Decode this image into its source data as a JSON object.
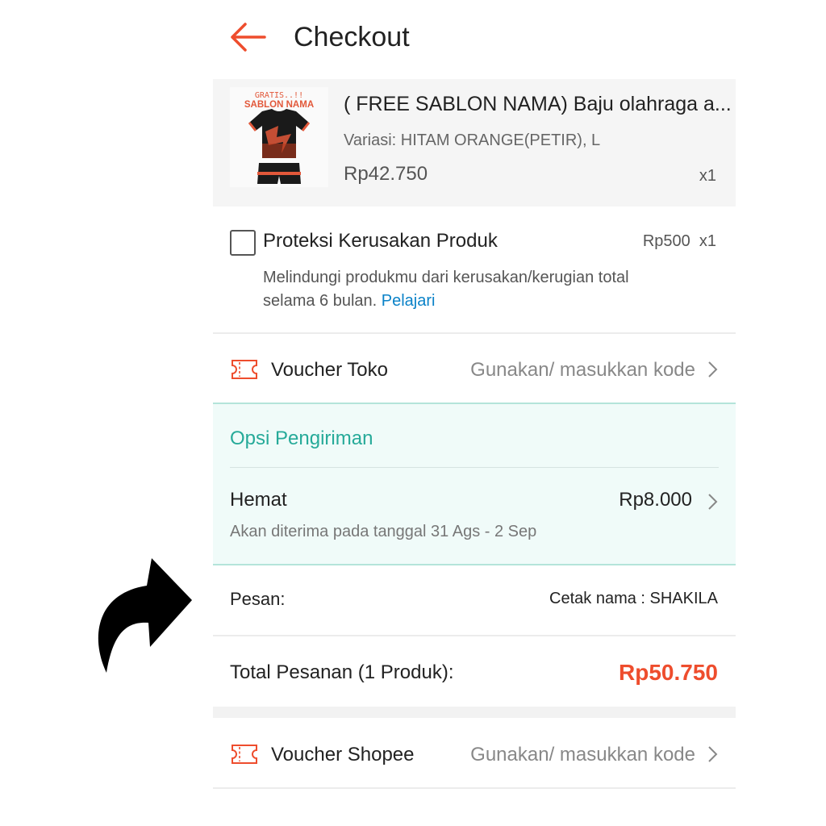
{
  "header": {
    "title": "Checkout"
  },
  "product": {
    "image_caption_top": "GRATIS..!!",
    "image_caption_main": "SABLON NAMA",
    "name": "( FREE SABLON NAMA) Baju olahraga a...",
    "variant": "Variasi: HITAM ORANGE(PETIR), L",
    "price": "Rp42.750",
    "qty": "x1"
  },
  "protection": {
    "title": "Proteksi Kerusakan Produk",
    "price_qty": "Rp500  x1",
    "desc": "Melindungi produkmu dari kerusakan/kerugian total selama 6 bulan.",
    "link": "Pelajari",
    "checked": false
  },
  "voucher_toko": {
    "label": "Voucher Toko",
    "hint": "Gunakan/ masukkan kode"
  },
  "shipping": {
    "section_title": "Opsi Pengiriman",
    "option": "Hemat",
    "price": "Rp8.000",
    "eta": "Akan diterima pada tanggal 31 Ags - 2 Sep"
  },
  "message": {
    "label": "Pesan:",
    "value": "Cetak nama : SHAKILA"
  },
  "total": {
    "label": "Total Pesanan (1 Produk):",
    "value": "Rp50.750"
  },
  "voucher_shopee": {
    "label": "Voucher Shopee",
    "hint": "Gunakan/ masukkan kode"
  },
  "colors": {
    "accent": "#ee4d2d",
    "shipping_accent": "#26aa99",
    "link": "#0a82c8"
  },
  "icons": [
    "back-arrow-icon",
    "voucher-ticket-icon",
    "chevron-right-icon",
    "curved-arrow-icon"
  ]
}
